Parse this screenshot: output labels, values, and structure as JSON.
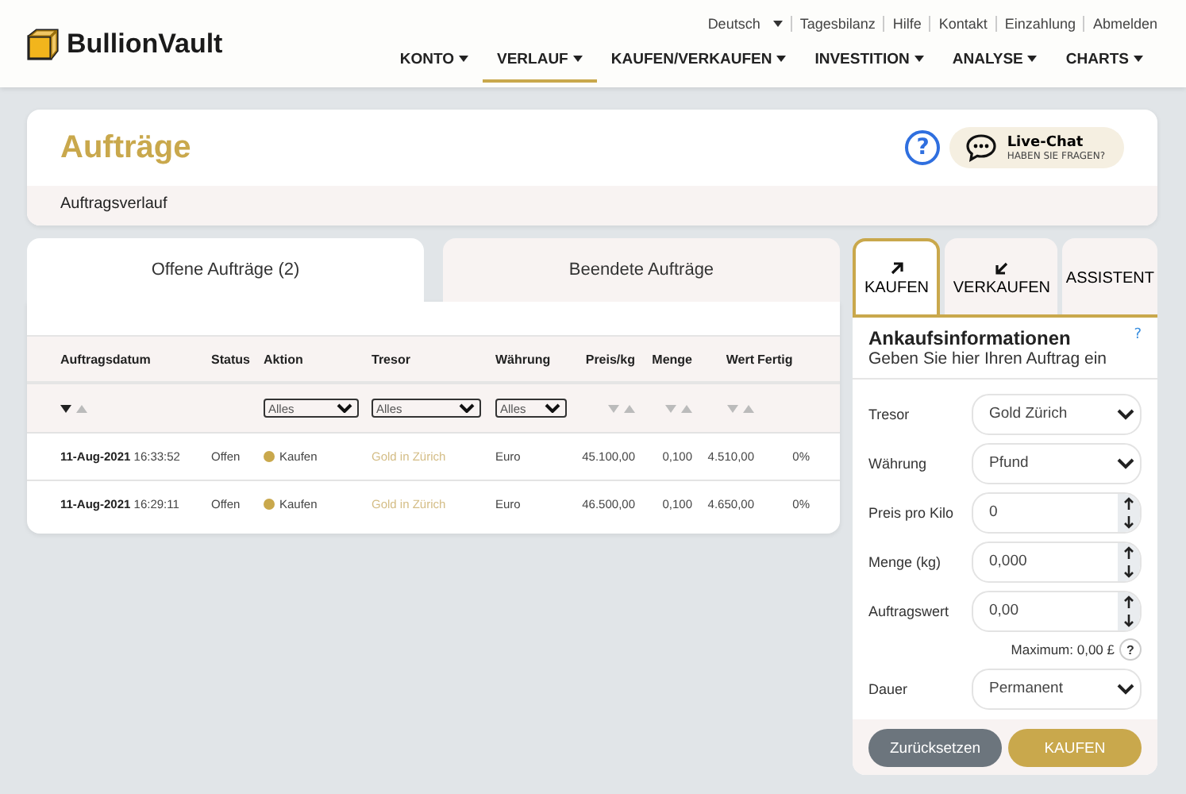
{
  "header": {
    "logo": "BullionVault",
    "top_links": [
      {
        "label": "Deutsch",
        "dropdown": true
      },
      {
        "label": "Tagesbilanz",
        "dropdown": false
      },
      {
        "label": "Hilfe",
        "dropdown": false
      },
      {
        "label": "Kontakt",
        "dropdown": false
      },
      {
        "label": "Einzahlung",
        "dropdown": false
      },
      {
        "label": "Abmelden",
        "dropdown": false
      }
    ],
    "nav": [
      {
        "label": "KONTO",
        "selected": false
      },
      {
        "label": "VERLAUF",
        "selected": true
      },
      {
        "label": "KAUFEN/VERKAUFEN",
        "selected": false
      },
      {
        "label": "INVESTITION",
        "selected": false
      },
      {
        "label": "ANALYSE",
        "selected": false
      },
      {
        "label": "CHARTS",
        "selected": false
      }
    ]
  },
  "page": {
    "title": "Aufträge",
    "help": "?",
    "chat": {
      "title": "Live-Chat",
      "subtitle": "HABEN SIE FRAGEN?"
    },
    "breadcrumb": "Auftragsverlauf"
  },
  "orders": {
    "tabs": [
      {
        "label": "Offene Aufträge (2)",
        "selected": true
      },
      {
        "label": "Beendete Aufträge",
        "selected": false
      }
    ],
    "columns": [
      {
        "label": "Auftragsdatum",
        "filter": {
          "kind": "sort",
          "sorted": true
        }
      },
      {
        "label": "Status"
      },
      {
        "label": "Aktion",
        "filter": {
          "kind": "select",
          "value": "Alles"
        }
      },
      {
        "label": "Tresor",
        "filter": {
          "kind": "select",
          "value": "Alles"
        }
      },
      {
        "label": "Währung",
        "filter": {
          "kind": "select",
          "value": "Alles"
        }
      },
      {
        "label": "Preis/kg",
        "filter": {
          "kind": "sort",
          "sorted": false
        }
      },
      {
        "label": "Menge",
        "filter": {
          "kind": "sort",
          "sorted": false
        }
      },
      {
        "label": "Wert",
        "filter": {
          "kind": "sort",
          "sorted": false
        }
      },
      {
        "label": "Fertig"
      }
    ],
    "rows": [
      {
        "date": "11-Aug-2021",
        "time": "16:33:52",
        "status": "Offen",
        "action": "Kaufen",
        "vault": "Gold in Zürich",
        "currency": "Euro",
        "price": "45.100,00",
        "quantity": "0,100",
        "value": "4.510,00",
        "done": "0%"
      },
      {
        "date": "11-Aug-2021",
        "time": "16:29:11",
        "status": "Offen",
        "action": "Kaufen",
        "vault": "Gold in Zürich",
        "currency": "Euro",
        "price": "46.500,00",
        "quantity": "0,100",
        "value": "4.650,00",
        "done": "0%"
      }
    ]
  },
  "trade": {
    "tabs": [
      {
        "label": "KAUFEN",
        "kind": "buy",
        "selected": true
      },
      {
        "label": "VERKAUFEN",
        "kind": "sell",
        "selected": false
      },
      {
        "label": "ASSISTENT",
        "kind": "assistant",
        "selected": false
      }
    ],
    "heading": "Ankaufsinformationen",
    "subheading": "Geben Sie hier Ihren Auftrag ein",
    "help": "?",
    "fields": [
      {
        "label": "Tresor",
        "kind": "select",
        "value": "Gold Zürich"
      },
      {
        "label": "Währung",
        "kind": "select",
        "value": "Pfund"
      },
      {
        "label": "Preis pro Kilo",
        "kind": "number",
        "value": "0"
      },
      {
        "label": "Menge (kg)",
        "kind": "number",
        "value": "0,000"
      },
      {
        "label": "Auftragswert",
        "kind": "number",
        "value": "0,00",
        "note": "Maximum: 0,00 £",
        "note_help": "?"
      },
      {
        "label": "Dauer",
        "kind": "select",
        "value": "Permanent"
      }
    ],
    "buttons": [
      {
        "label": "Zurücksetzen",
        "kind": "secondary"
      },
      {
        "label": "KAUFEN",
        "kind": "primary"
      }
    ]
  }
}
